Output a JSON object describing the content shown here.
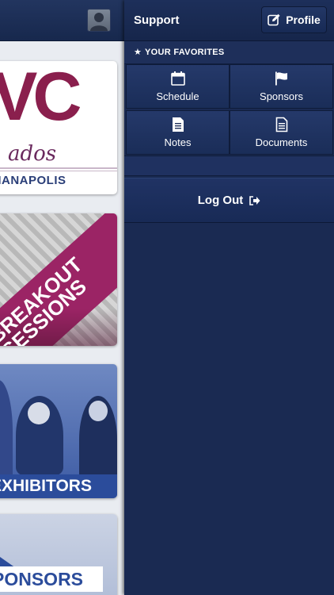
{
  "left": {
    "logo_card": {
      "letters": "VC",
      "script": "ados",
      "city": "DIANAPOLIS"
    },
    "breakout_card": {
      "line1": "BREAKOUT",
      "line2": "SESSIONS"
    },
    "exhibitors_card": {
      "label": "EXHIBITORS"
    },
    "sponsors_card": {
      "label": "PONSORS"
    }
  },
  "menu": {
    "title": "Support",
    "profile_label": "Profile",
    "favorites_title": "YOUR FAVORITES",
    "favorites": [
      {
        "label": "Schedule",
        "icon": "calendar-icon"
      },
      {
        "label": "Sponsors",
        "icon": "flag-icon"
      },
      {
        "label": "Notes",
        "icon": "note-icon"
      },
      {
        "label": "Documents",
        "icon": "document-icon"
      }
    ],
    "logout_label": "Log Out"
  },
  "colors": {
    "panel": "#1a2a52",
    "accent_magenta": "#9b2465",
    "accent_blue": "#2b4c9b"
  }
}
